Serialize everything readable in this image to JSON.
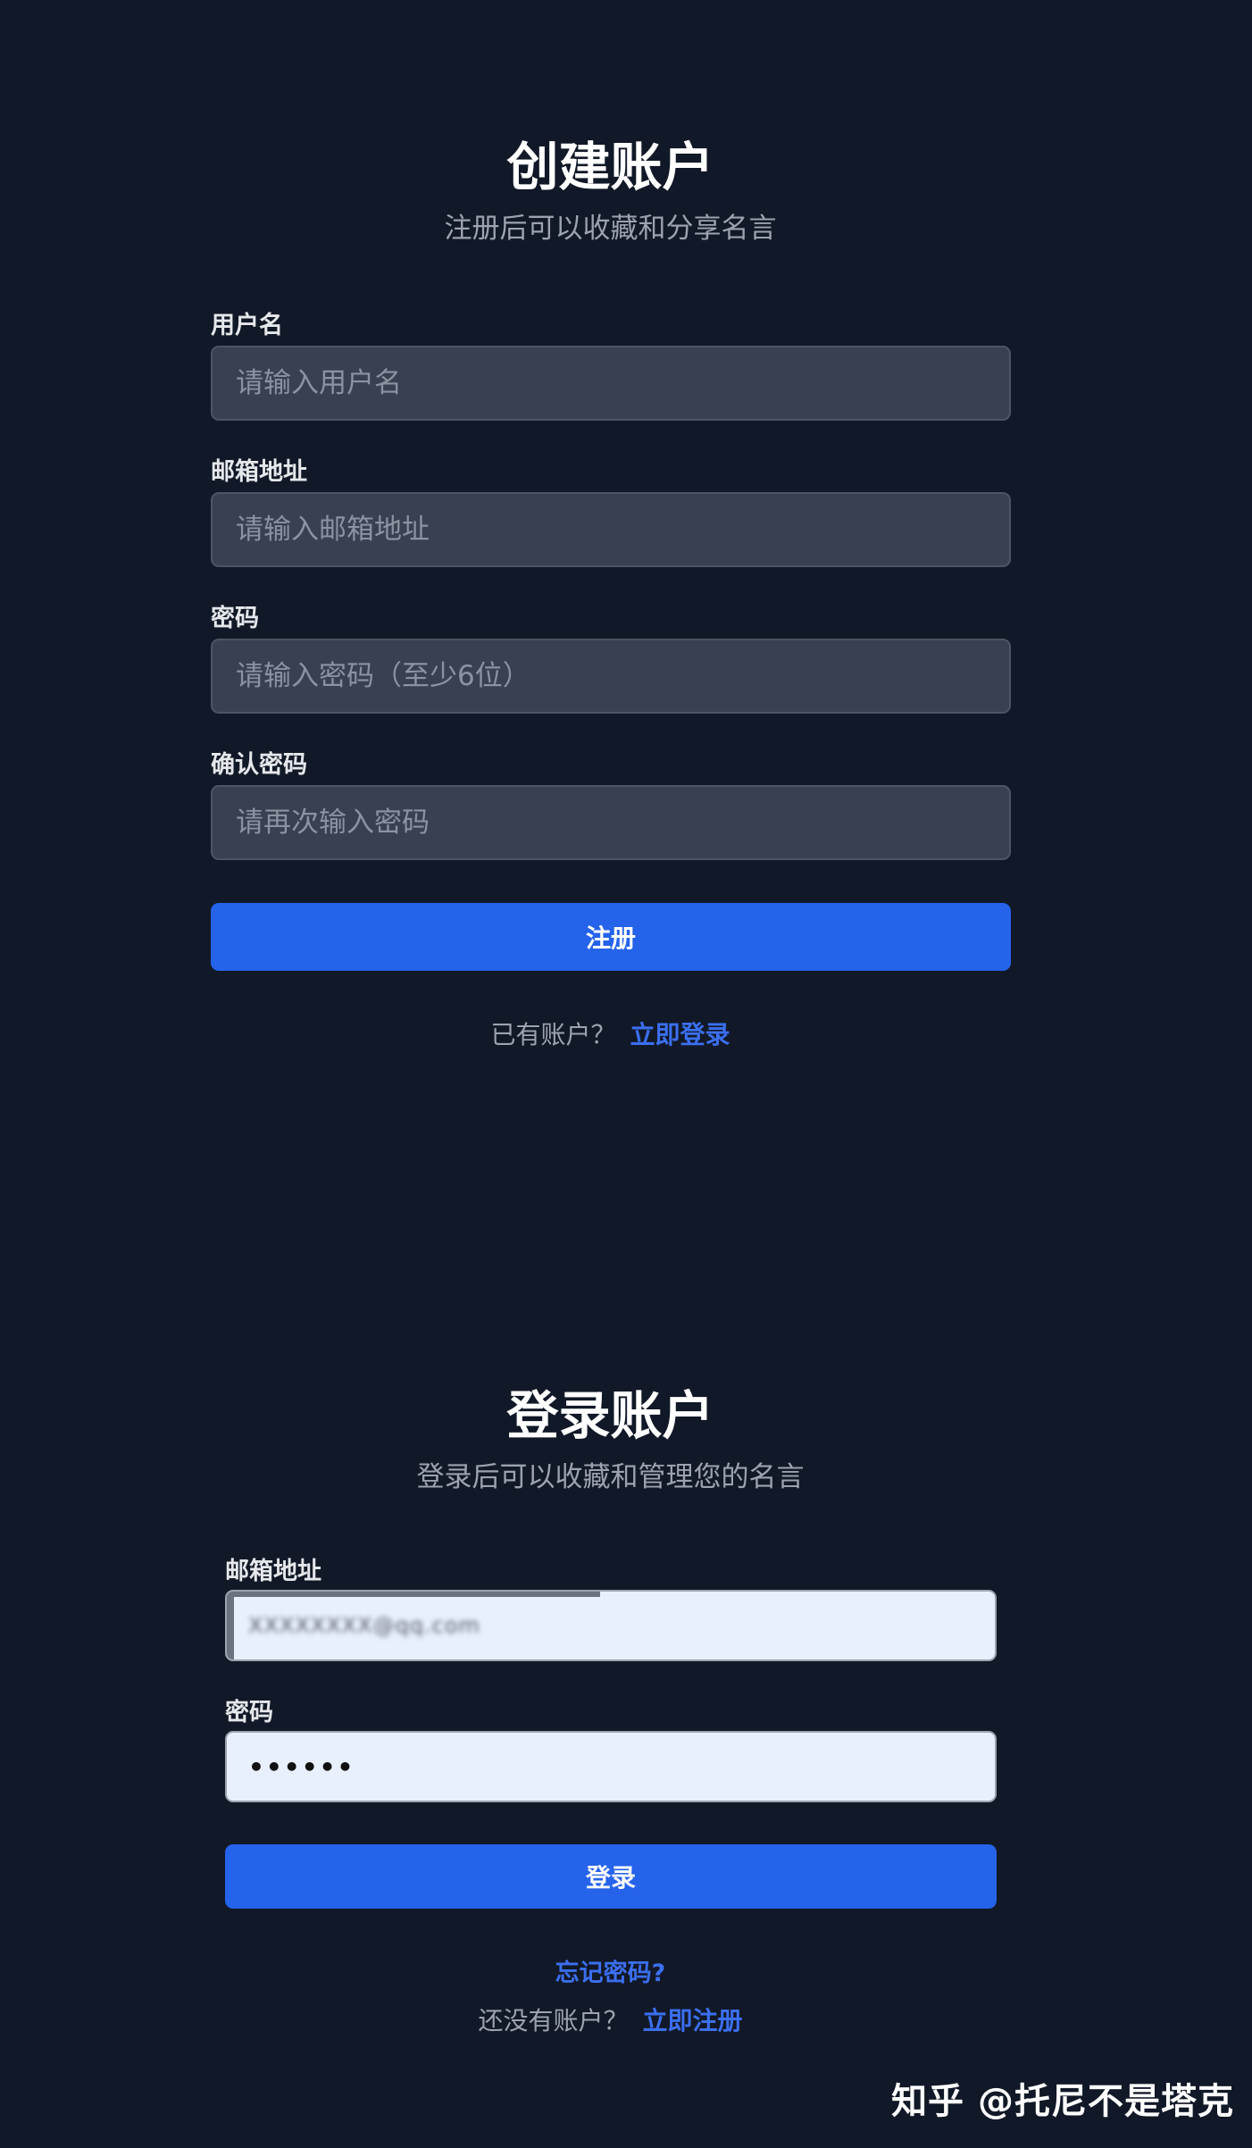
{
  "register": {
    "title": "创建账户",
    "subtitle": "注册后可以收藏和分享名言",
    "username_label": "用户名",
    "username_placeholder": "请输入用户名",
    "email_label": "邮箱地址",
    "email_placeholder": "请输入邮箱地址",
    "password_label": "密码",
    "password_placeholder": "请输入密码（至少6位）",
    "confirm_label": "确认密码",
    "confirm_placeholder": "请再次输入密码",
    "submit_label": "注册",
    "switch_prompt": "已有账户？",
    "switch_link": "立即登录"
  },
  "login": {
    "title": "登录账户",
    "subtitle": "登录后可以收藏和管理您的名言",
    "email_label": "邮箱地址",
    "email_value": "XXXXXXXX@qq.com",
    "password_label": "密码",
    "password_value": "••••••",
    "submit_label": "登录",
    "forgot_link": "忘记密码?",
    "switch_prompt": "还没有账户？",
    "switch_link": "立即注册"
  },
  "watermark": "知乎 @托尼不是塔克",
  "colors": {
    "background": "#111827",
    "input_dark": "#374151",
    "input_light": "#e8f0fe",
    "primary": "#2563eb",
    "link": "#3b6ff0",
    "muted": "#9ca3af"
  }
}
